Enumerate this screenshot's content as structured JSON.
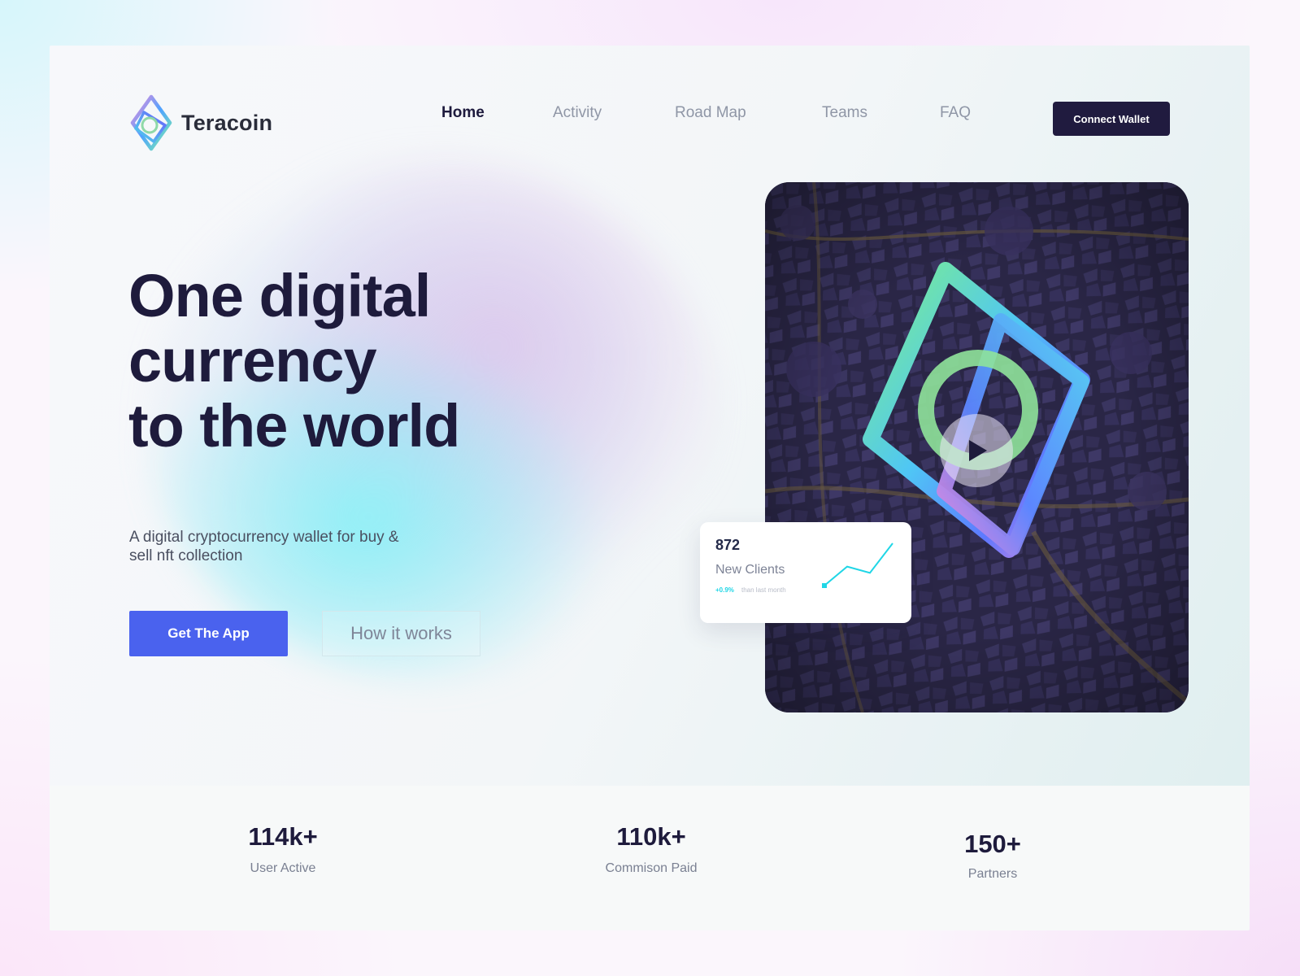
{
  "brand": {
    "name": "Teracoin",
    "logo_icon": "diamond-ring-logo"
  },
  "nav": {
    "items": [
      {
        "label": "Home",
        "active": true
      },
      {
        "label": "Activity",
        "active": false
      },
      {
        "label": "Road Map",
        "active": false
      },
      {
        "label": "Teams",
        "active": false
      },
      {
        "label": "FAQ",
        "active": false
      }
    ],
    "connect_label": "Connect Wallet"
  },
  "hero": {
    "headline": [
      "One digital",
      "currency",
      "to the world"
    ],
    "subtitle": "A digital cryptocurrency wallet for buy & sell nft  collection",
    "primary_cta": "Get The App",
    "secondary_cta": "How it works"
  },
  "media": {
    "play_icon": "play-icon"
  },
  "stat_card": {
    "value": "872",
    "label": "New Clients",
    "change": "+0.9%",
    "note": "than last month",
    "trend": [
      0,
      0.45,
      0.3,
      1
    ]
  },
  "stats": [
    {
      "value": "114k+",
      "label": "User Active"
    },
    {
      "value": "110k+",
      "label": "Commison Paid"
    },
    {
      "value": "150+",
      "label": "Partners"
    }
  ],
  "colors": {
    "primary": "#4a62ee",
    "dark": "#1e1b3c",
    "accent": "#20d6e6"
  }
}
